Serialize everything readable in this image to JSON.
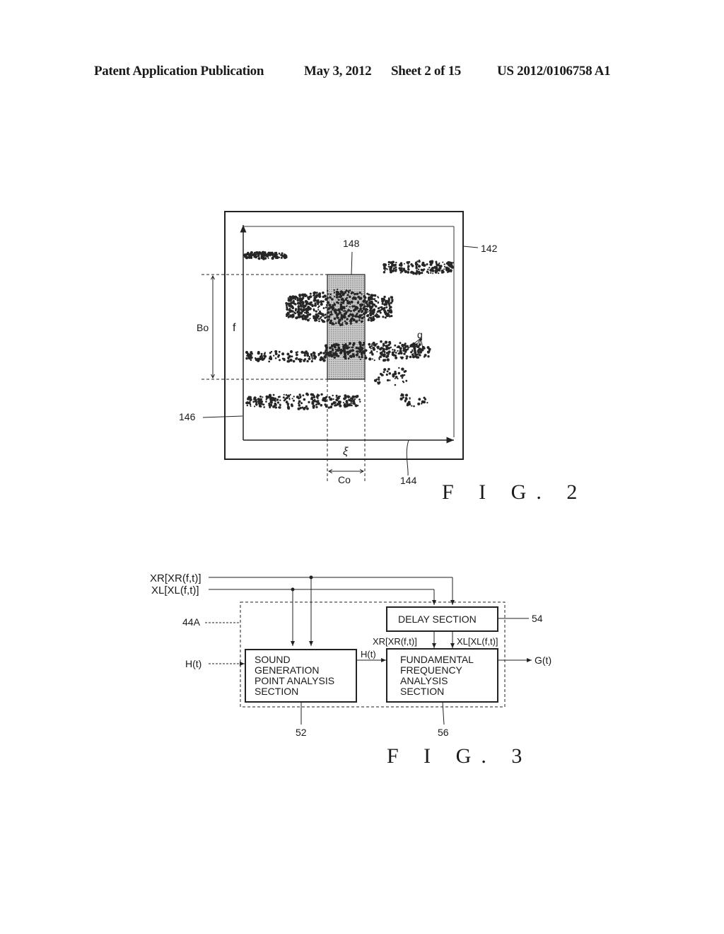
{
  "header": {
    "publication": "Patent Application Publication",
    "date": "May 3, 2012",
    "sheet": "Sheet 2 of 15",
    "number": "US 2012/0106758 A1"
  },
  "fig2": {
    "caption": "F I G. 2",
    "refs": {
      "frame": "142",
      "x_axis": "144",
      "y_axis": "146",
      "window": "148",
      "points": "q"
    },
    "labels": {
      "y_axis": "f",
      "x_axis": "ξ",
      "band_height": "Bo",
      "band_width": "Co"
    }
  },
  "fig3": {
    "caption": "F I G. 3",
    "inputs": {
      "xr": "XR[XR(f,t)]",
      "xl": "XL[XL(f,t)]",
      "h": "H(t)"
    },
    "output": "G(t)",
    "unit_ref": "44A",
    "blocks": {
      "sound_gen": {
        "ref": "52",
        "lines": [
          "SOUND",
          "GENERATION",
          "POINT ANALYSIS",
          "SECTION"
        ]
      },
      "delay": {
        "ref": "54",
        "lines": [
          "DELAY SECTION"
        ]
      },
      "fundamental": {
        "ref": "56",
        "lines": [
          "FUNDAMENTAL",
          "FREQUENCY",
          "ANALYSIS",
          "SECTION"
        ]
      }
    },
    "internal_signals": {
      "h": "H(t)",
      "xr": "XR[XR(f,t)]",
      "xl": "XL[XL(f,t)]"
    }
  }
}
